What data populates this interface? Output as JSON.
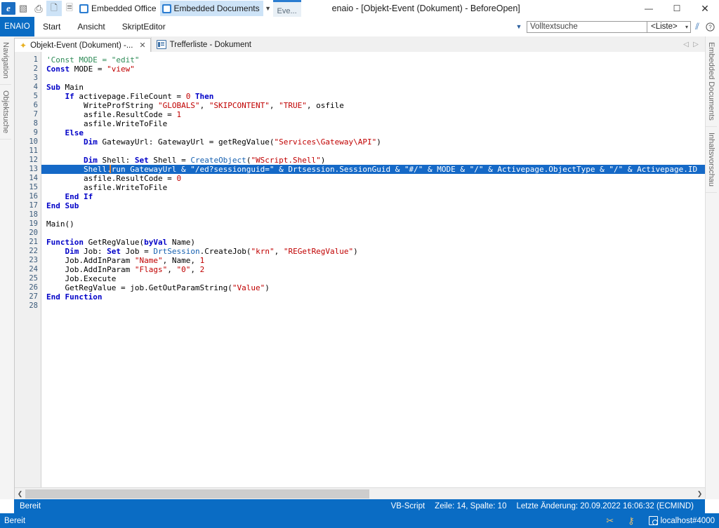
{
  "window": {
    "title": "enaio  - [Objekt-Event (Dokument) - BeforeOpen]",
    "minimize": "—",
    "maximize": "☐",
    "close": "✕"
  },
  "quick_access": {
    "logo": "e",
    "items": [
      {
        "name": "edit-icon",
        "glyph": "▧"
      },
      {
        "name": "print-icon",
        "glyph": "⎙"
      },
      {
        "name": "document-check-icon",
        "glyph": "🗋"
      },
      {
        "name": "copy-icon",
        "glyph": "🗏"
      }
    ],
    "embedded_office": "Embedded Office",
    "embedded_documents": "Embedded Documents",
    "dropdown": "▼",
    "eve_tab": "Eve..."
  },
  "ribbon": {
    "brand": "ENAIO",
    "tabs": [
      "Start",
      "Ansicht",
      "SkriptEditor"
    ],
    "caret": "▼",
    "search_value": "Volltextsuche",
    "search_placeholder": "Volltextsuche",
    "list_selector": "<Liste>",
    "list_caret": "▾",
    "tools_icon": "⫽",
    "help_icon": "?"
  },
  "left_dock": [
    "Navigation",
    "Objektsuche"
  ],
  "right_dock": [
    "Embedded Documents",
    "Inhaltsvorschau"
  ],
  "doc_tabs": [
    {
      "label": "Objekt-Event (Dokument) -...",
      "icon": "star-icon",
      "active": true,
      "close": "✕"
    },
    {
      "label": "Trefferliste - Dokument",
      "icon": "list-icon",
      "active": false,
      "close": ""
    }
  ],
  "tab_nav": {
    "prev": "◁",
    "next": "▷"
  },
  "editor": {
    "total_lines": 28,
    "highlighted_line": 13,
    "lines": [
      {
        "n": 1,
        "tokens": [
          {
            "t": "'Const MODE = \"edit\"",
            "c": "c"
          }
        ]
      },
      {
        "n": 2,
        "tokens": [
          {
            "t": "Const ",
            "c": "k"
          },
          {
            "t": "MODE = ",
            "c": ""
          },
          {
            "t": "\"view\"",
            "c": "s"
          }
        ]
      },
      {
        "n": 3,
        "tokens": []
      },
      {
        "n": 4,
        "tokens": [
          {
            "t": "Sub ",
            "c": "k"
          },
          {
            "t": "Main",
            "c": ""
          }
        ]
      },
      {
        "n": 5,
        "tokens": [
          {
            "t": "    If ",
            "c": "k"
          },
          {
            "t": "activepage.FileCount = ",
            "c": ""
          },
          {
            "t": "0",
            "c": "n"
          },
          {
            "t": " Then",
            "c": "k"
          }
        ]
      },
      {
        "n": 6,
        "tokens": [
          {
            "t": "        WriteProfString ",
            "c": ""
          },
          {
            "t": "\"GLOBALS\"",
            "c": "s"
          },
          {
            "t": ", ",
            "c": ""
          },
          {
            "t": "\"SKIPCONTENT\"",
            "c": "s"
          },
          {
            "t": ", ",
            "c": ""
          },
          {
            "t": "\"TRUE\"",
            "c": "s"
          },
          {
            "t": ", osfile",
            "c": ""
          }
        ]
      },
      {
        "n": 7,
        "tokens": [
          {
            "t": "        asfile.ResultCode = ",
            "c": ""
          },
          {
            "t": "1",
            "c": "n"
          }
        ]
      },
      {
        "n": 8,
        "tokens": [
          {
            "t": "        asfile.WriteToFile",
            "c": ""
          }
        ]
      },
      {
        "n": 9,
        "tokens": [
          {
            "t": "    Else",
            "c": "k"
          }
        ]
      },
      {
        "n": 10,
        "tokens": [
          {
            "t": "        Dim ",
            "c": "k"
          },
          {
            "t": "GatewayUrl: GatewayUrl = getRegValue(",
            "c": ""
          },
          {
            "t": "\"Services\\Gateway\\API\"",
            "c": "s"
          },
          {
            "t": ")",
            "c": ""
          }
        ]
      },
      {
        "n": 11,
        "tokens": []
      },
      {
        "n": 12,
        "tokens": [
          {
            "t": "        Dim ",
            "c": "k"
          },
          {
            "t": "Shell: ",
            "c": ""
          },
          {
            "t": "Set ",
            "c": "k"
          },
          {
            "t": "Shell = ",
            "c": ""
          },
          {
            "t": "CreateObject",
            "c": "f"
          },
          {
            "t": "(",
            "c": ""
          },
          {
            "t": "\"WScript.Shell\"",
            "c": "s"
          },
          {
            "t": ")",
            "c": ""
          }
        ]
      },
      {
        "n": 13,
        "tokens": [
          {
            "t": "        Shell.run GatewayUrl & \"/ed?sessionguid=\" & Drtsession.SessionGuid & \"#/\" & MODE & \"/\" & Activepage.ObjectType & \"/\" & Activepage.ID",
            "c": ""
          }
        ]
      },
      {
        "n": 14,
        "tokens": [
          {
            "t": "        asfile.ResultCode = ",
            "c": ""
          },
          {
            "t": "0",
            "c": "n"
          }
        ]
      },
      {
        "n": 15,
        "tokens": [
          {
            "t": "        asfile.WriteToFile",
            "c": ""
          }
        ]
      },
      {
        "n": 16,
        "tokens": [
          {
            "t": "    End If",
            "c": "k"
          }
        ]
      },
      {
        "n": 17,
        "tokens": [
          {
            "t": "End Sub",
            "c": "k"
          }
        ]
      },
      {
        "n": 18,
        "tokens": []
      },
      {
        "n": 19,
        "tokens": [
          {
            "t": "Main()",
            "c": ""
          }
        ]
      },
      {
        "n": 20,
        "tokens": []
      },
      {
        "n": 21,
        "tokens": [
          {
            "t": "Function ",
            "c": "k"
          },
          {
            "t": "GetRegValue(",
            "c": ""
          },
          {
            "t": "byVal ",
            "c": "k"
          },
          {
            "t": "Name)",
            "c": ""
          }
        ]
      },
      {
        "n": 22,
        "tokens": [
          {
            "t": "    Dim ",
            "c": "k"
          },
          {
            "t": "Job: ",
            "c": ""
          },
          {
            "t": "Set ",
            "c": "k"
          },
          {
            "t": "Job = ",
            "c": ""
          },
          {
            "t": "DrtSession",
            "c": "f"
          },
          {
            "t": ".CreateJob(",
            "c": ""
          },
          {
            "t": "\"krn\"",
            "c": "s"
          },
          {
            "t": ", ",
            "c": ""
          },
          {
            "t": "\"REGetRegValue\"",
            "c": "s"
          },
          {
            "t": ")",
            "c": ""
          }
        ]
      },
      {
        "n": 23,
        "tokens": [
          {
            "t": "    Job.AddInParam ",
            "c": ""
          },
          {
            "t": "\"Name\"",
            "c": "s"
          },
          {
            "t": ", Name, ",
            "c": ""
          },
          {
            "t": "1",
            "c": "n"
          }
        ]
      },
      {
        "n": 24,
        "tokens": [
          {
            "t": "    Job.AddInParam ",
            "c": ""
          },
          {
            "t": "\"Flags\"",
            "c": "s"
          },
          {
            "t": ", ",
            "c": ""
          },
          {
            "t": "\"0\"",
            "c": "s"
          },
          {
            "t": ", ",
            "c": ""
          },
          {
            "t": "2",
            "c": "n"
          }
        ]
      },
      {
        "n": 25,
        "tokens": [
          {
            "t": "    Job.Execute",
            "c": ""
          }
        ]
      },
      {
        "n": 26,
        "tokens": [
          {
            "t": "    GetRegValue = job.GetOutParamString(",
            "c": ""
          },
          {
            "t": "\"Value\"",
            "c": "s"
          },
          {
            "t": ")",
            "c": ""
          }
        ]
      },
      {
        "n": 27,
        "tokens": [
          {
            "t": "End Function",
            "c": "k"
          }
        ]
      },
      {
        "n": 28,
        "tokens": []
      }
    ],
    "hscroll": {
      "left_arrow": "❮",
      "right_arrow": "❯"
    }
  },
  "status_editor": {
    "ready": "Bereit",
    "language": "VB-Script",
    "position": "Zeile: 14, Spalte: 10",
    "last_change": "Letzte Änderung: 20.09.2022 16:06:32 (ECMIND)"
  },
  "status_app": {
    "ready": "Bereit",
    "icons": [
      {
        "name": "scissors-icon",
        "glyph": "✂"
      },
      {
        "name": "key-icon",
        "glyph": "⚷"
      }
    ],
    "host": "localhost#4000"
  },
  "colors": {
    "accent": "#0a6cc4",
    "selection": "#1569c7",
    "keyword": "#0000c8",
    "string": "#c00000",
    "comment": "#2e8b57",
    "function": "#1560b0"
  }
}
